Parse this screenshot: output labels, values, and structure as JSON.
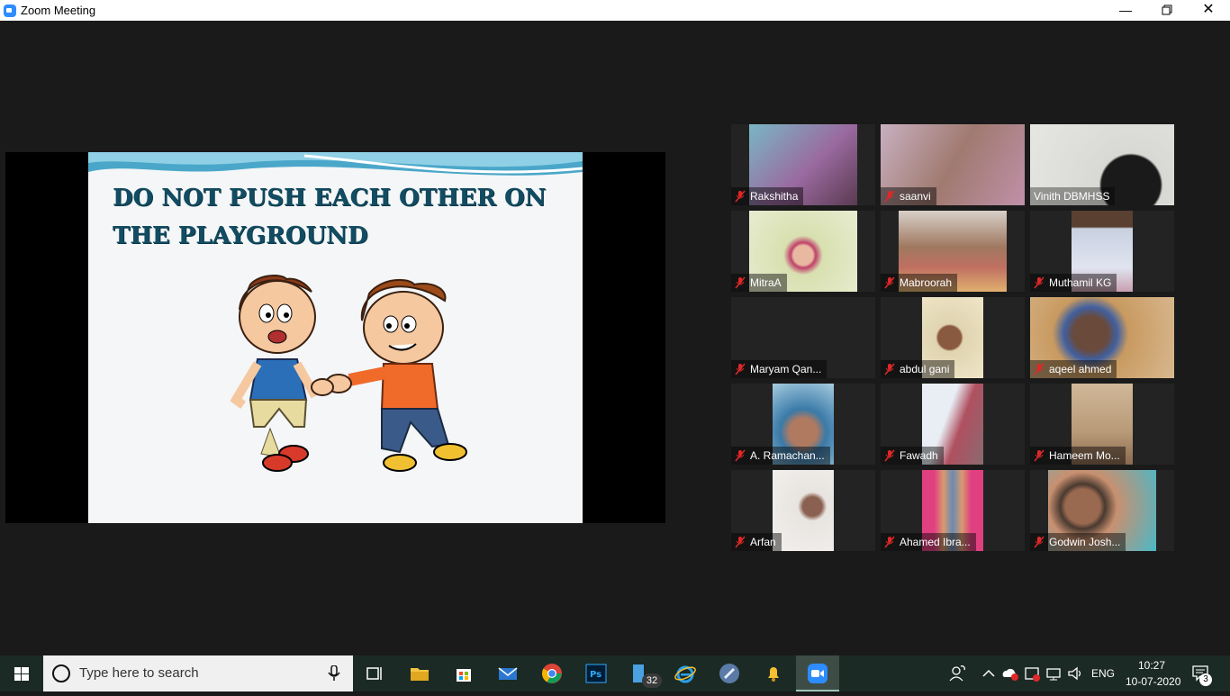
{
  "window": {
    "title": "Zoom Meeting"
  },
  "slide": {
    "title": "DO NOT PUSH EACH OTHER ON THE PLAYGROUND"
  },
  "participants": [
    {
      "name": "Rakshitha"
    },
    {
      "name": "saanvi"
    },
    {
      "name": "Vinith DBMHSS"
    },
    {
      "name": "MitraA"
    },
    {
      "name": "Mabroorah"
    },
    {
      "name": "Muthamil KG"
    },
    {
      "name": "Maryam Qan..."
    },
    {
      "name": "abdul gani"
    },
    {
      "name": "aqeel ahmed"
    },
    {
      "name": "A. Ramachan..."
    },
    {
      "name": "Fawadh"
    },
    {
      "name": "Hameem Mo..."
    },
    {
      "name": "Arfan"
    },
    {
      "name": "Ahamed Ibra..."
    },
    {
      "name": "Godwin Josh..."
    }
  ],
  "taskbar": {
    "search_placeholder": "Type here to search",
    "store_badge": "32",
    "language": "ENG",
    "time": "10:27",
    "date": "10-07-2020",
    "notification_count": "3"
  },
  "colors": {
    "zoom_blue": "#2d8cff",
    "mic_muted_red": "#e02828",
    "slide_title": "#124c62"
  }
}
